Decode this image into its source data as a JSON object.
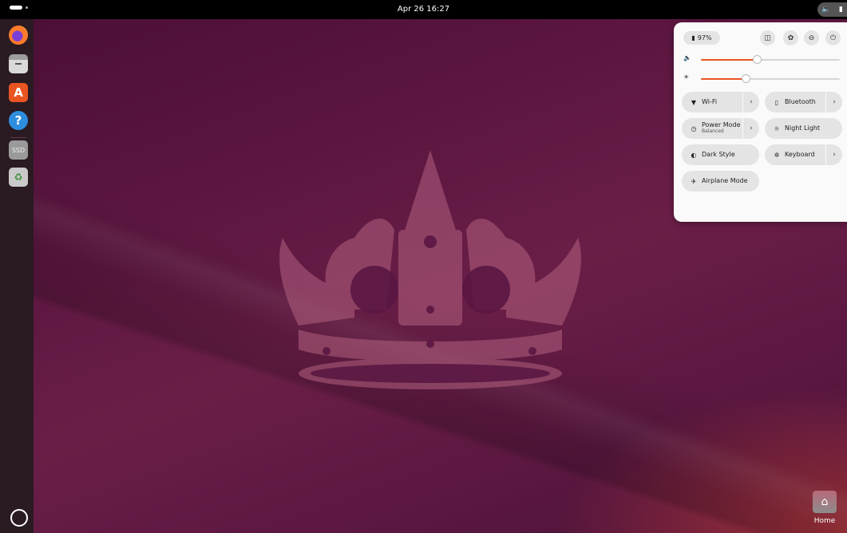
{
  "topbar": {
    "clock": "Apr 26  16:27",
    "volume_icon": "speaker-icon",
    "battery_icon": "battery-icon"
  },
  "dock": {
    "items": [
      {
        "name": "Firefox",
        "icon": "firefox-icon"
      },
      {
        "name": "Files",
        "icon": "files-icon"
      },
      {
        "name": "App Center",
        "icon": "app-center-icon"
      },
      {
        "name": "Help",
        "icon": "help-icon",
        "glyph": "?"
      },
      {
        "name": "SSD",
        "icon": "drive-icon",
        "glyph": "SSD"
      },
      {
        "name": "Trash",
        "icon": "trash-icon",
        "glyph": "♻"
      }
    ],
    "show_apps_icon": "ubuntu-logo-icon"
  },
  "desktop": {
    "home_label": "Home"
  },
  "quick_settings": {
    "battery_label": "97%",
    "volume_level": 0.41,
    "brightness_level": 0.33,
    "tiles": {
      "wifi": {
        "label": "Wi-Fi",
        "icon": "wifi-icon"
      },
      "bluetooth": {
        "label": "Bluetooth",
        "icon": "bluetooth-icon"
      },
      "power_mode": {
        "label": "Power Mode",
        "sublabel": "Balanced",
        "icon": "power-mode-icon"
      },
      "night_light": {
        "label": "Night Light",
        "icon": "night-light-icon"
      },
      "dark_style": {
        "label": "Dark Style",
        "icon": "dark-style-icon"
      },
      "keyboard": {
        "label": "Keyboard",
        "icon": "keyboard-icon"
      },
      "airplane": {
        "label": "Airplane Mode",
        "icon": "airplane-icon"
      }
    }
  },
  "colors": {
    "accent": "#e95420",
    "panel_bg": "#fafafa",
    "tile_bg": "#e4e4e4",
    "topbar_bg": "#000000"
  }
}
